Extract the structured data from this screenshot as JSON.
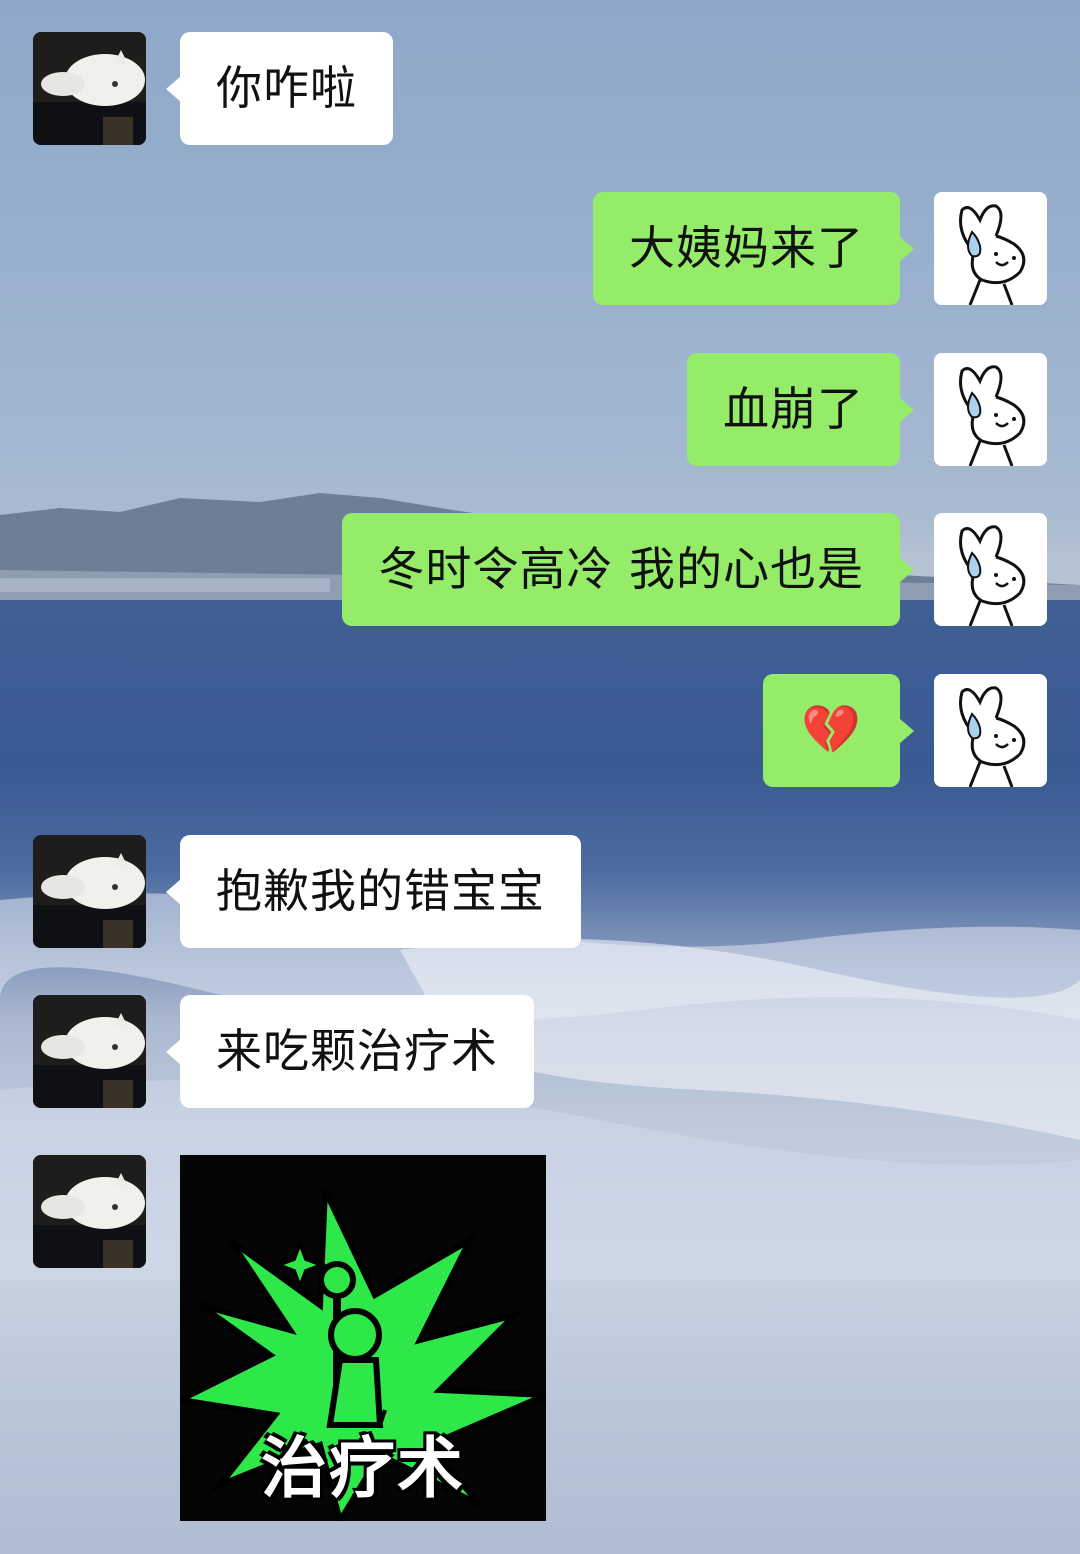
{
  "messages": [
    {
      "side": "left",
      "avatar": "cat-avatar",
      "text": "你咋啦"
    },
    {
      "side": "right",
      "avatar": "bunny-avatar",
      "text": "大姨妈来了"
    },
    {
      "side": "right",
      "avatar": "bunny-avatar",
      "text": "血崩了"
    },
    {
      "side": "right",
      "avatar": "bunny-avatar",
      "text": "冬时令高冷 我的心也是"
    },
    {
      "side": "right",
      "avatar": "bunny-avatar",
      "text": "💔"
    },
    {
      "side": "left",
      "avatar": "cat-avatar",
      "text": "抱歉我的错宝宝"
    },
    {
      "side": "left",
      "avatar": "cat-avatar",
      "text": "来吃颗治疗术"
    },
    {
      "side": "left",
      "avatar": "cat-avatar",
      "sticker_caption": "治疗术"
    }
  ],
  "colors": {
    "sent_bubble": "#95ec69",
    "received_bubble": "#ffffff",
    "sticker_green": "#2ee84a"
  },
  "icons": {
    "broken_heart": "broken-heart-emoji",
    "sticker": "healing-spell-sticker"
  }
}
